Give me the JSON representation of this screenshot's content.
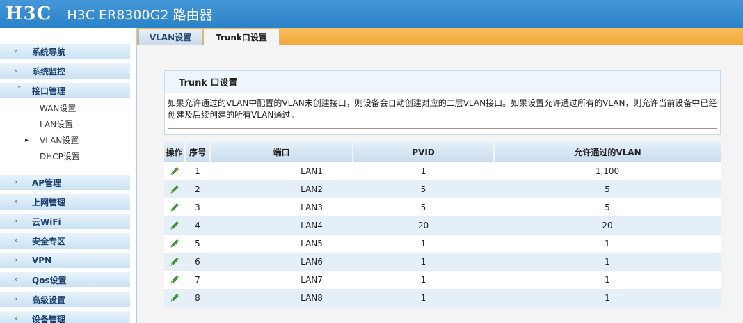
{
  "header": {
    "logo": "H3C",
    "title": "H3C ER8300G2 路由器"
  },
  "sidebar": {
    "items": [
      {
        "label": "系统导航",
        "arrow": "»"
      },
      {
        "label": "系统监控",
        "arrow": "»"
      },
      {
        "label": "接口管理",
        "arrow": "»"
      },
      {
        "label": "AP管理",
        "arrow": "»"
      },
      {
        "label": "上网管理",
        "arrow": "»"
      },
      {
        "label": "云WiFi",
        "arrow": "»"
      },
      {
        "label": "安全专区",
        "arrow": "»"
      },
      {
        "label": "VPN",
        "arrow": "»"
      },
      {
        "label": "Qos设置",
        "arrow": "»"
      },
      {
        "label": "高级设置",
        "arrow": "»"
      },
      {
        "label": "设备管理",
        "arrow": "»"
      }
    ],
    "sub_items": [
      {
        "label": "WAN设置"
      },
      {
        "label": "LAN设置"
      },
      {
        "label": "VLAN设置",
        "marker": "▸"
      },
      {
        "label": "DHCP设置"
      }
    ]
  },
  "tabs": [
    {
      "label": "VLAN设置",
      "active": false
    },
    {
      "label": "Trunk口设置",
      "active": true
    }
  ],
  "panel": {
    "title": "Trunk 口设置",
    "description": "如果允许通过的VLAN中配置的VLAN未创建接口，则设备会自动创建对应的二层VLAN接口。如果设置允许通过所有的VLAN，则允许当前设备中已经创建及后续创建的所有VLAN通过。"
  },
  "table": {
    "headers": {
      "op": "操作",
      "seq": "序号",
      "port": "端口",
      "pvid": "PVID",
      "vlan": "允许通过的VLAN"
    },
    "rows": [
      {
        "seq": "1",
        "port": "LAN1",
        "pvid": "1",
        "vlan": "1,100"
      },
      {
        "seq": "2",
        "port": "LAN2",
        "pvid": "5",
        "vlan": "5"
      },
      {
        "seq": "3",
        "port": "LAN3",
        "pvid": "5",
        "vlan": "5"
      },
      {
        "seq": "4",
        "port": "LAN4",
        "pvid": "20",
        "vlan": "20"
      },
      {
        "seq": "5",
        "port": "LAN5",
        "pvid": "1",
        "vlan": "1"
      },
      {
        "seq": "6",
        "port": "LAN6",
        "pvid": "1",
        "vlan": "1"
      },
      {
        "seq": "7",
        "port": "LAN7",
        "pvid": "1",
        "vlan": "1"
      },
      {
        "seq": "8",
        "port": "LAN8",
        "pvid": "1",
        "vlan": "1"
      }
    ],
    "row_icon": "edit-pencil-icon"
  }
}
